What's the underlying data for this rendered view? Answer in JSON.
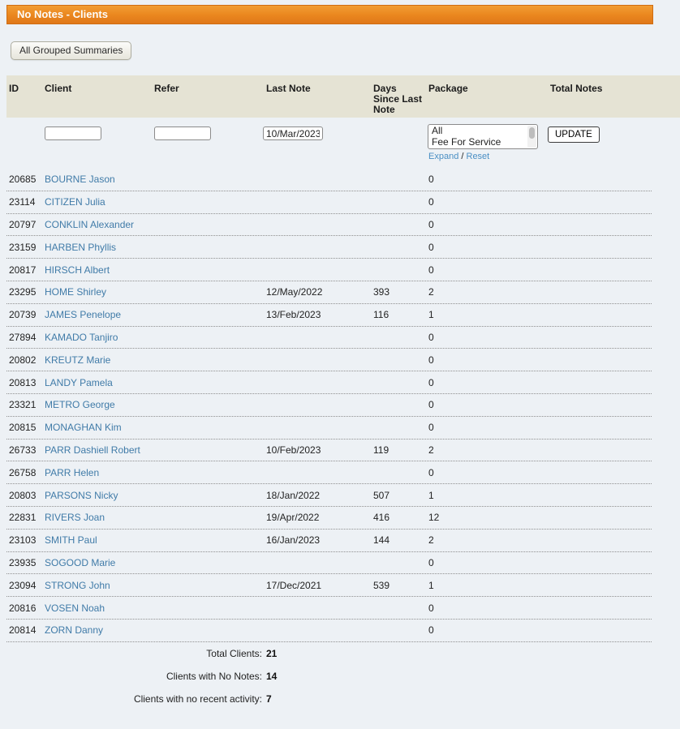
{
  "title_bar": {
    "text": "No Notes - Clients"
  },
  "toolbar": {
    "grouped_summaries_label": "All Grouped Summaries"
  },
  "filters": {
    "client_value": "",
    "refer_value": "",
    "last_note_value": "10/Mar/2023",
    "package_options": [
      "All",
      "Fee For Service"
    ],
    "expand_label": "Expand",
    "separator": "/",
    "reset_label": "Reset",
    "update_label": "UPDATE"
  },
  "table": {
    "headers": {
      "id": "ID",
      "client": "Client",
      "refer": "Refer",
      "last_note": "Last Note",
      "days_since": "Days Since Last Note",
      "package": "Package",
      "total_notes": "Total Notes"
    },
    "rows": [
      {
        "id": "20685",
        "client": "BOURNE Jason",
        "refer": "",
        "last_note": "",
        "days_since": "",
        "total_notes": "0"
      },
      {
        "id": "23114",
        "client": "CITIZEN Julia",
        "refer": "",
        "last_note": "",
        "days_since": "",
        "total_notes": "0"
      },
      {
        "id": "20797",
        "client": "CONKLIN Alexander",
        "refer": "",
        "last_note": "",
        "days_since": "",
        "total_notes": "0"
      },
      {
        "id": "23159",
        "client": "HARBEN Phyllis",
        "refer": "",
        "last_note": "",
        "days_since": "",
        "total_notes": "0"
      },
      {
        "id": "20817",
        "client": "HIRSCH Albert",
        "refer": "",
        "last_note": "",
        "days_since": "",
        "total_notes": "0"
      },
      {
        "id": "23295",
        "client": "HOME Shirley",
        "refer": "",
        "last_note": "12/May/2022",
        "days_since": "393",
        "total_notes": "2"
      },
      {
        "id": "20739",
        "client": "JAMES Penelope",
        "refer": "",
        "last_note": "13/Feb/2023",
        "days_since": "116",
        "total_notes": "1"
      },
      {
        "id": "27894",
        "client": "KAMADO Tanjiro",
        "refer": "",
        "last_note": "",
        "days_since": "",
        "total_notes": "0"
      },
      {
        "id": "20802",
        "client": "KREUTZ Marie",
        "refer": "",
        "last_note": "",
        "days_since": "",
        "total_notes": "0"
      },
      {
        "id": "20813",
        "client": "LANDY Pamela",
        "refer": "",
        "last_note": "",
        "days_since": "",
        "total_notes": "0"
      },
      {
        "id": "23321",
        "client": "METRO George",
        "refer": "",
        "last_note": "",
        "days_since": "",
        "total_notes": "0"
      },
      {
        "id": "20815",
        "client": "MONAGHAN Kim",
        "refer": "",
        "last_note": "",
        "days_since": "",
        "total_notes": "0"
      },
      {
        "id": "26733",
        "client": "PARR Dashiell Robert",
        "refer": "",
        "last_note": "10/Feb/2023",
        "days_since": "119",
        "total_notes": "2"
      },
      {
        "id": "26758",
        "client": "PARR Helen",
        "refer": "",
        "last_note": "",
        "days_since": "",
        "total_notes": "0"
      },
      {
        "id": "20803",
        "client": "PARSONS Nicky",
        "refer": "",
        "last_note": "18/Jan/2022",
        "days_since": "507",
        "total_notes": "1"
      },
      {
        "id": "22831",
        "client": "RIVERS Joan",
        "refer": "",
        "last_note": "19/Apr/2022",
        "days_since": "416",
        "total_notes": "12"
      },
      {
        "id": "23103",
        "client": "SMITH Paul",
        "refer": "",
        "last_note": "16/Jan/2023",
        "days_since": "144",
        "total_notes": "2"
      },
      {
        "id": "23935",
        "client": "SOGOOD Marie",
        "refer": "",
        "last_note": "",
        "days_since": "",
        "total_notes": "0"
      },
      {
        "id": "23094",
        "client": "STRONG John",
        "refer": "",
        "last_note": "17/Dec/2021",
        "days_since": "539",
        "total_notes": "1"
      },
      {
        "id": "20816",
        "client": "VOSEN Noah",
        "refer": "",
        "last_note": "",
        "days_since": "",
        "total_notes": "0"
      },
      {
        "id": "20814",
        "client": "ZORN Danny",
        "refer": "",
        "last_note": "",
        "days_since": "",
        "total_notes": "0"
      }
    ]
  },
  "summary": [
    {
      "label": "Total Clients:",
      "value": "21"
    },
    {
      "label": "Clients with No Notes:",
      "value": "14"
    },
    {
      "label": "Clients with no recent activity:",
      "value": "7"
    }
  ],
  "colors": {
    "accent_orange": "#ea861e",
    "header_beige": "#e5e3d4",
    "link_blue": "#407ba8",
    "action_link_blue": "#4a8fc4",
    "page_bg": "#edf1f5"
  }
}
